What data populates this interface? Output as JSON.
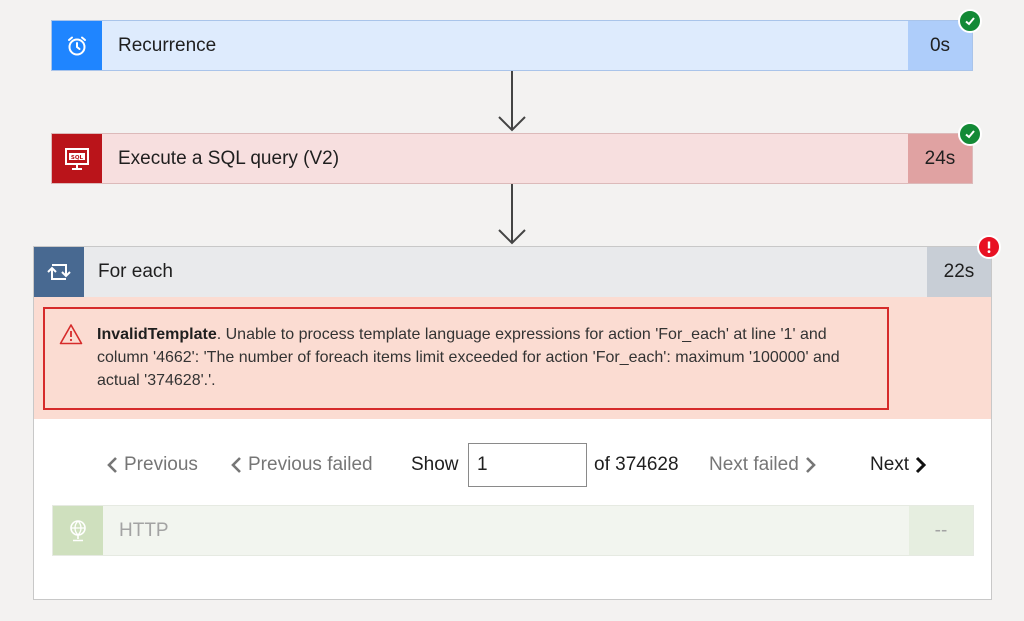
{
  "flow": {
    "recurrence": {
      "title": "Recurrence",
      "duration": "0s",
      "status": "succeeded",
      "icon": "alarm-clock-icon",
      "accent": "#1f85ff"
    },
    "sql": {
      "title": "Execute a SQL query (V2)",
      "duration": "24s",
      "status": "succeeded",
      "icon": "sql-server-icon",
      "accent": "#ba141a"
    },
    "foreach": {
      "title": "For each",
      "duration": "22s",
      "status": "failed",
      "icon": "loop-icon",
      "accent": "#486991",
      "error": {
        "code": "InvalidTemplate",
        "message": ". Unable to process template language expressions for action 'For_each' at line '1' and column '4662': 'The number of foreach items limit exceeded for action 'For_each': maximum '100000' and actual '374628'.'."
      },
      "pager": {
        "previous_label": "Previous",
        "previous_failed_label": "Previous failed",
        "show_label": "Show",
        "current_value": "1",
        "of_label": "of 374628",
        "next_failed_label": "Next failed",
        "next_label": "Next"
      },
      "http": {
        "title": "HTTP",
        "duration": "--",
        "icon": "globe-icon",
        "status": "skipped"
      }
    }
  },
  "colors": {
    "success": "#138a36",
    "error": "#e81123"
  }
}
